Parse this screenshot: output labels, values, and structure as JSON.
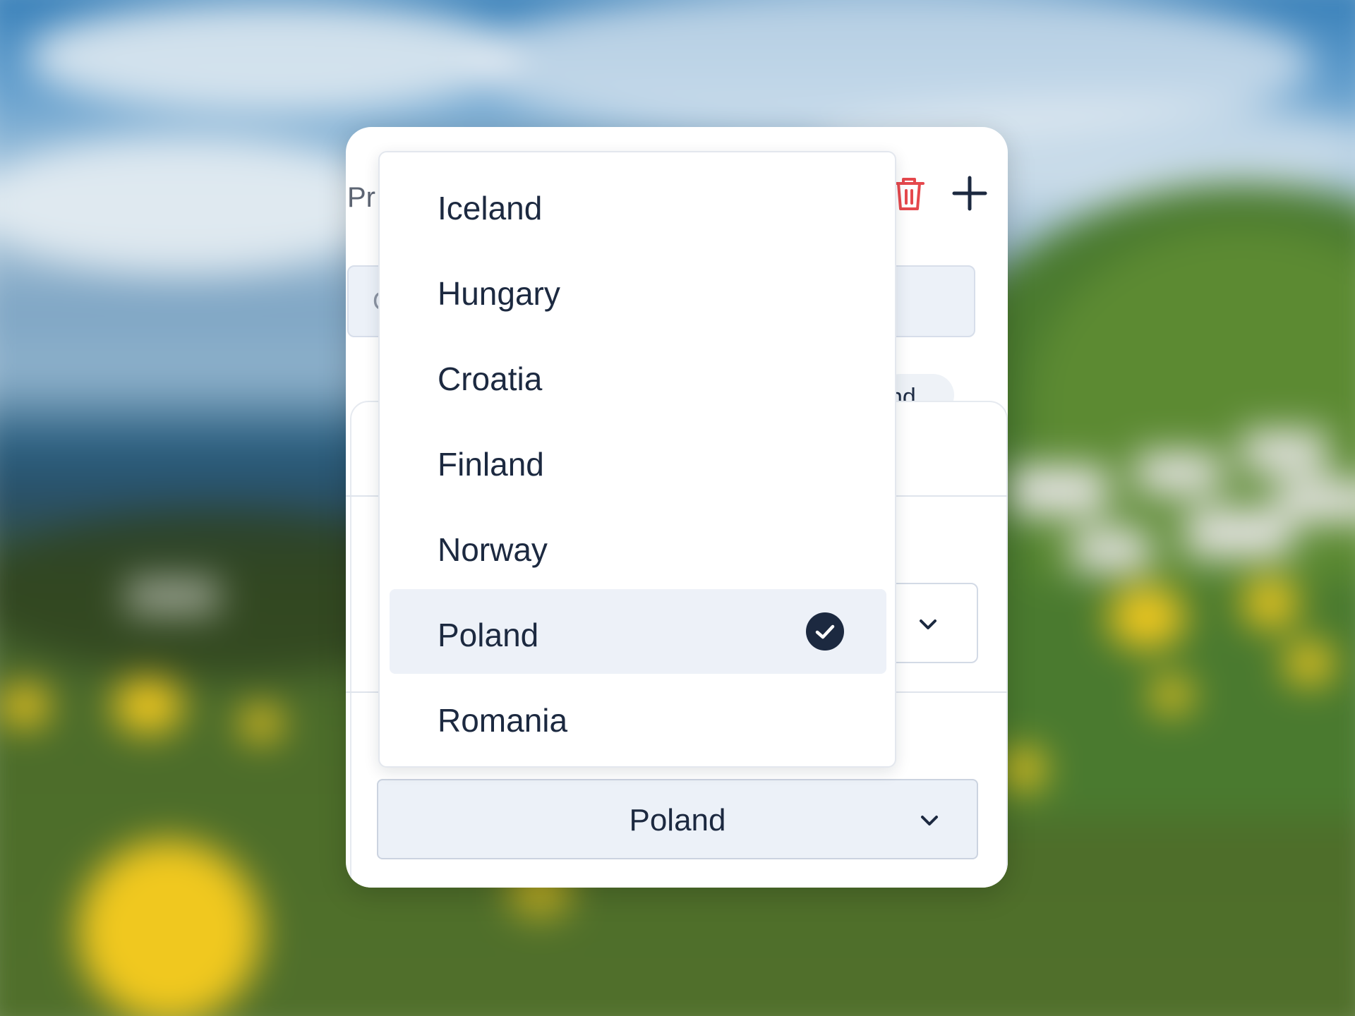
{
  "header": {
    "title": "Pr",
    "trash_color": "#e5484d"
  },
  "search": {
    "placeholder": "C"
  },
  "tags": {
    "chip_text": "nd"
  },
  "country_select": {
    "value": "Poland"
  },
  "dropdown": {
    "options": [
      {
        "label": "Iceland",
        "selected": false
      },
      {
        "label": "Hungary",
        "selected": false
      },
      {
        "label": "Croatia",
        "selected": false
      },
      {
        "label": "Finland",
        "selected": false
      },
      {
        "label": "Norway",
        "selected": false
      },
      {
        "label": "Poland",
        "selected": true
      },
      {
        "label": "Romania",
        "selected": false
      }
    ]
  },
  "colors": {
    "text": "#1c2940",
    "selected_bg": "#edf1f8",
    "check_bg": "#1c2940",
    "field_bg": "#ecf1f8"
  },
  "icons": [
    "trash-icon",
    "plus-icon",
    "chevron-down-icon",
    "check-circle-icon"
  ]
}
